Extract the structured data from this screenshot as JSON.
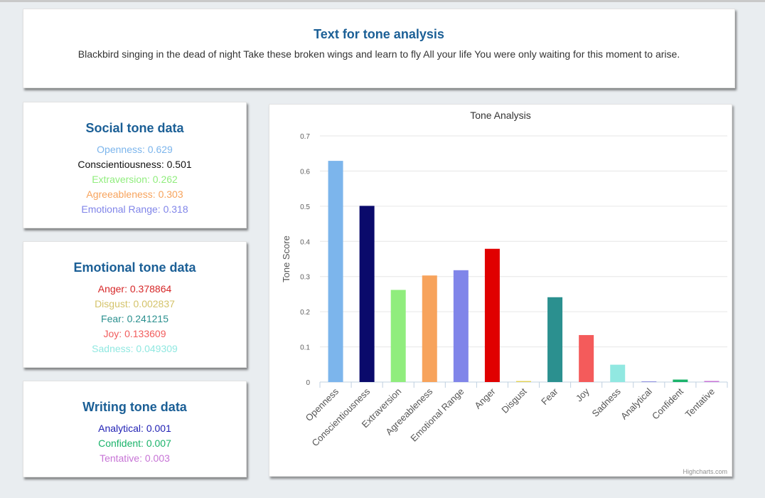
{
  "text_card": {
    "title": "Text for tone analysis",
    "text": "Blackbird singing in the dead of night Take these broken wings and learn to fly All your life You were only waiting for this moment to arise."
  },
  "social": {
    "title": "Social tone data",
    "items": [
      {
        "text": "Openness: 0.629",
        "color": "#7cb5ec"
      },
      {
        "text": "Conscientiousness: 0.501",
        "color": "#111111"
      },
      {
        "text": "Extraversion: 0.262",
        "color": "#90ed7d"
      },
      {
        "text": "Agreeableness: 0.303",
        "color": "#f7a35c"
      },
      {
        "text": "Emotional Range: 0.318",
        "color": "#8085e9"
      }
    ]
  },
  "emotional": {
    "title": "Emotional tone data",
    "items": [
      {
        "text": "Anger: 0.378864",
        "color": "#d62728"
      },
      {
        "text": "Disgust: 0.002837",
        "color": "#d4c36a"
      },
      {
        "text": "Fear: 0.241215",
        "color": "#2b908f"
      },
      {
        "text": "Joy: 0.133609",
        "color": "#f15c5c"
      },
      {
        "text": "Sadness: 0.049309",
        "color": "#91e8e1"
      }
    ]
  },
  "writing": {
    "title": "Writing tone data",
    "items": [
      {
        "text": "Analytical: 0.001",
        "color": "#1f1fb4"
      },
      {
        "text": "Confident: 0.007",
        "color": "#1ab36a"
      },
      {
        "text": "Tentative: 0.003",
        "color": "#c774d6"
      }
    ]
  },
  "chart_data": {
    "type": "bar",
    "title": "Tone Analysis",
    "ylabel": "Tone Score",
    "xlabel": "",
    "credits": "Highcharts.com",
    "categories": [
      "Openness",
      "Conscientiousness",
      "Extraversion",
      "Agreeableness",
      "Emotional Range",
      "Anger",
      "Disgust",
      "Fear",
      "Joy",
      "Sadness",
      "Analytical",
      "Confident",
      "Tentative"
    ],
    "values": [
      0.629,
      0.501,
      0.262,
      0.303,
      0.318,
      0.378864,
      0.002837,
      0.241215,
      0.133609,
      0.049309,
      0.001,
      0.007,
      0.003
    ],
    "colors": [
      "#7cb5ec",
      "#0a0a6b",
      "#90ed7d",
      "#f7a35c",
      "#8085e9",
      "#e00000",
      "#e4d354",
      "#2b908f",
      "#f45b5b",
      "#91e8e1",
      "#2020c0",
      "#1ab36a",
      "#c774d6"
    ],
    "ylim": [
      0,
      0.7
    ],
    "yticks": [
      "0",
      "0.1",
      "0.2",
      "0.3",
      "0.4",
      "0.5",
      "0.6",
      "0.7"
    ],
    "grid": true
  }
}
